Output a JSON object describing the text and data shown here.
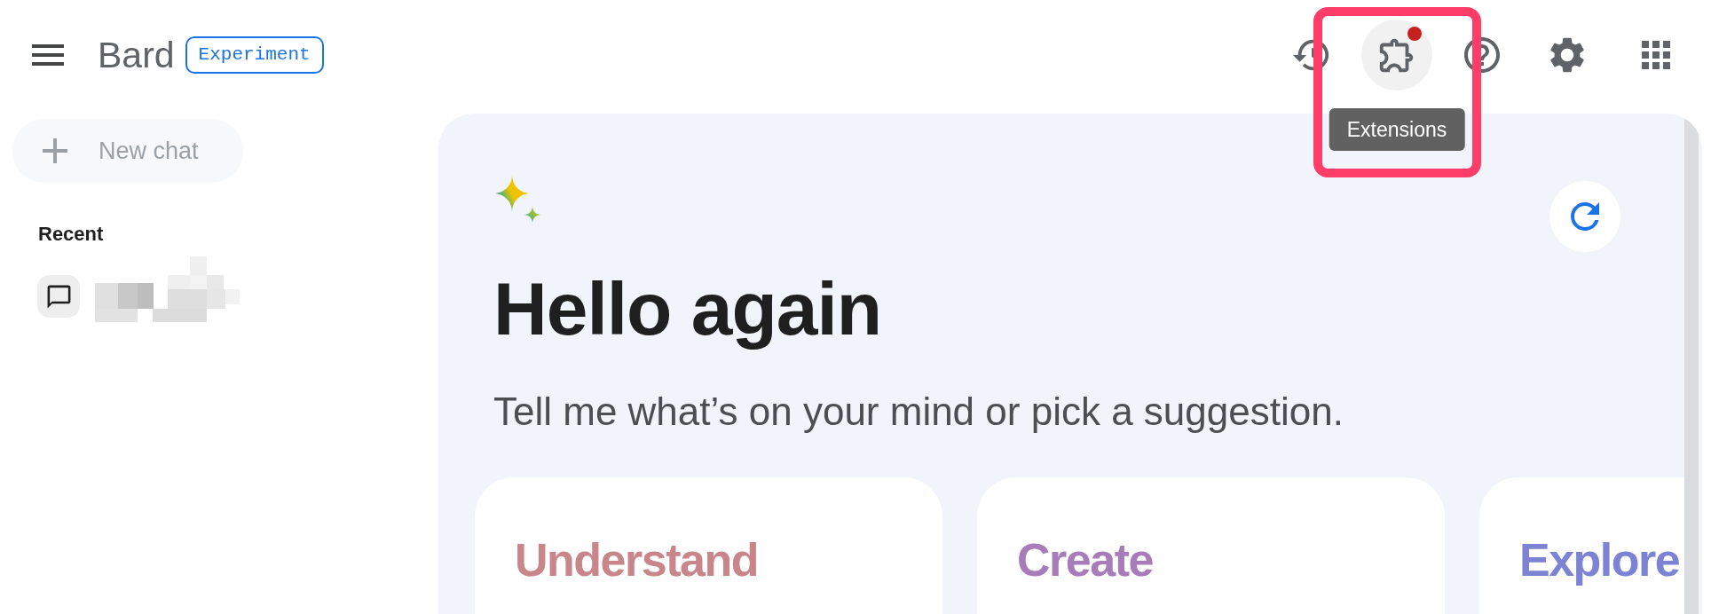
{
  "header": {
    "app_name": "Bard",
    "badge": "Experiment"
  },
  "toolbar": [
    {
      "kind": "history",
      "hovered": false,
      "notification": false,
      "annotated": false
    },
    {
      "kind": "extensions",
      "hovered": true,
      "notification": true,
      "annotated": true,
      "tooltip": "Extensions"
    },
    {
      "kind": "help",
      "hovered": false,
      "notification": false,
      "annotated": false
    },
    {
      "kind": "settings",
      "hovered": false,
      "notification": false,
      "annotated": false
    },
    {
      "kind": "apps",
      "hovered": false,
      "notification": false,
      "annotated": false
    }
  ],
  "sidebar": {
    "new_chat": {
      "label": "New chat",
      "disabled": true
    },
    "recent_heading": "Recent",
    "recent_chats": [
      {
        "kind": "pixelated"
      }
    ]
  },
  "main": {
    "greeting": "Hello again",
    "prompt": "Tell me what’s on your mind or pick a suggestion.",
    "suggestion_cards": [
      {
        "title": "Understand",
        "color": "#c8858a"
      },
      {
        "title": "Create",
        "color": "#a87cba"
      },
      {
        "title": "Explore",
        "color": "#7c82d4"
      }
    ]
  }
}
